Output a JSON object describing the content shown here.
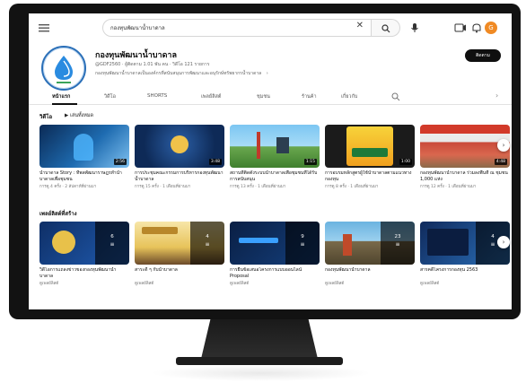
{
  "search": {
    "query": "กองทุนพัฒนาน้ำบาดาล",
    "clear": "✕"
  },
  "header": {
    "avatar_letter": "G"
  },
  "channel": {
    "title": "กองทุนพัฒนาน้ำบาดาล",
    "meta": "@GDF2560 · ผู้ติดตาม 1.01 พัน คน · วิดีโอ 121 รายการ",
    "description": "กองทุนพัฒนาน้ำบาดาลเป็นองค์กรที่สนับสนุนการพัฒนาและอนุรักษ์ทรัพยากรน้ำบาดาล",
    "desc_more": "›",
    "subscribe_label": "ติดตาม"
  },
  "tabs": [
    "หน้าแรก",
    "วิดีโอ",
    "SHORTS",
    "เพลย์ลิสต์",
    "ชุมชน",
    "ร้านค้า",
    "เกี่ยวกับ"
  ],
  "videos_section": {
    "title": "วิดีโอ",
    "play_all": "▶  เล่นทั้งหมด",
    "items": [
      {
        "title": "น้ำบาดาล Story : ที่พลพัฒนาราษฎรทำน้ำบาดาลเพื่อชุมชน",
        "meta": "การดู 4 ครั้ง · 2 สัปดาห์ที่ผ่านมา",
        "duration": "2:56"
      },
      {
        "title": "การประชุมคณะกรรมการบริหารกองทุนพัฒนาน้ำบาดาล",
        "meta": "การดู 15 ครั้ง · 1 เดือนที่ผ่านมา",
        "duration": "3:48"
      },
      {
        "title": "สถานที่ติดตั้งระบบน้ำบาดาลเพื่อชุมชนที่ได้รับการสนับสนุน",
        "meta": "การดู 13 ครั้ง · 1 เดือนที่ผ่านมา",
        "duration": "1:15"
      },
      {
        "title": "การอบรมหลักสูตรผู้ใช้น้ำบาดาลตามแนวทางกองทุน",
        "meta": "การดู 8 ครั้ง · 1 เดือนที่ผ่านมา",
        "duration": "1:00"
      },
      {
        "title": "กองทุนพัฒนาน้ำบาดาล ร่วมลงพื้นที่ ณ ชุมชน 1,000 แห่ง",
        "meta": "การดู 12 ครั้ง · 1 เดือนที่ผ่านมา",
        "duration": "4:48"
      }
    ]
  },
  "playlists_section": {
    "title": "เพลย์ลิสต์ที่สร้าง",
    "view_link": "ดูเพลย์ลิสต์",
    "items": [
      {
        "title": "วิดีโอการแถลงข่าวของกองทุนพัฒนาน้ำบาดาล",
        "count": "6"
      },
      {
        "title": "สาระดี ๆ กับน้ำบาดาล",
        "count": "4"
      },
      {
        "title": "การยื่นข้อเสนอโครงการแบบออนไลน์ Proposal",
        "count": "9"
      },
      {
        "title": "กองทุนพัฒนาน้ำบาดาล",
        "count": "23"
      },
      {
        "title": "สารคดีโครงการกองทุน 2563",
        "count": "4"
      }
    ]
  },
  "colors": {
    "accent": "#0f0f0f",
    "brand_blue": "#2a6fb8",
    "avatar": "#f08a24"
  }
}
